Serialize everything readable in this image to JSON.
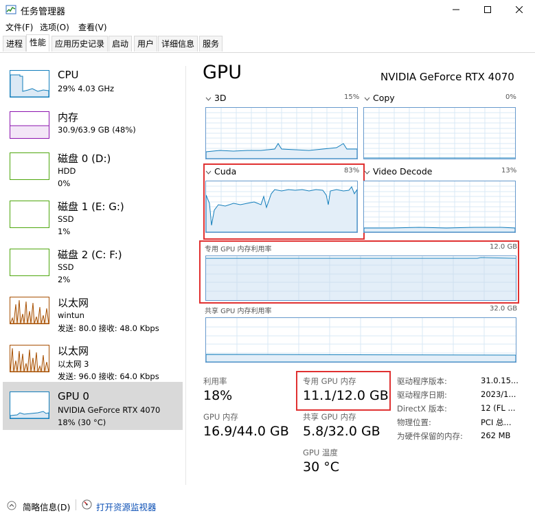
{
  "window": {
    "title": "任务管理器"
  },
  "menu": {
    "file": "文件(F)",
    "options": "选项(O)",
    "view": "查看(V)"
  },
  "tabs": [
    "进程",
    "性能",
    "应用历史记录",
    "启动",
    "用户",
    "详细信息",
    "服务"
  ],
  "sidebar": {
    "cpu": {
      "title": "CPU",
      "line2": "29%  4.03 GHz"
    },
    "memory": {
      "title": "内存",
      "line2": "30.9/63.9 GB (48%)"
    },
    "disk0": {
      "title": "磁盘 0 (D:)",
      "line2": "HDD",
      "line3": "0%"
    },
    "disk1": {
      "title": "磁盘 1 (E: G:)",
      "line2": "SSD",
      "line3": "1%"
    },
    "disk2": {
      "title": "磁盘 2 (C: F:)",
      "line2": "SSD",
      "line3": "2%"
    },
    "eth1": {
      "title": "以太网",
      "line2": "wintun",
      "line3": "发送: 80.0 接收: 48.0 Kbps"
    },
    "eth2": {
      "title": "以太网",
      "line2": "以太网 3",
      "line3": "发送: 96.0 接收: 64.0 Kbps"
    },
    "gpu0": {
      "title": "GPU 0",
      "line2": "NVIDIA GeForce RTX 4070",
      "line3": "18% (30 °C)"
    }
  },
  "main": {
    "title": "GPU",
    "gpu_name": "NVIDIA GeForce RTX 4070",
    "engines": [
      {
        "label": "3D",
        "pct": "15%"
      },
      {
        "label": "Copy",
        "pct": "0%"
      },
      {
        "label": "Cuda",
        "pct": "83%"
      },
      {
        "label": "Video Decode",
        "pct": "13%"
      }
    ],
    "dedicated": {
      "label": "专用 GPU 内存利用率",
      "max": "12.0 GB"
    },
    "shared": {
      "label": "共享 GPU 内存利用率",
      "max": "32.0 GB"
    }
  },
  "stats": {
    "utilization": {
      "label": "利用率",
      "value": "18%"
    },
    "dedicated_mem": {
      "label": "专用 GPU 内存",
      "value": "11.1/12.0 GB"
    },
    "gpu_mem": {
      "label": "GPU 内存",
      "value": "16.9/44.0 GB"
    },
    "shared_mem": {
      "label": "共享 GPU 内存",
      "value": "5.8/32.0 GB"
    },
    "temp": {
      "label": "GPU 温度",
      "value": "30 °C"
    }
  },
  "info": [
    {
      "label": "驱动程序版本:",
      "value": "31.0.15..."
    },
    {
      "label": "驱动程序日期:",
      "value": "2023/1..."
    },
    {
      "label": "DirectX 版本:",
      "value": "12 (FL ..."
    },
    {
      "label": "物理位置:",
      "value": "PCI 总..."
    },
    {
      "label": "为硬件保留的内存:",
      "value": "262 MB"
    }
  ],
  "footer": {
    "brief": "简略信息(D)",
    "monitor": "打开资源监视器"
  },
  "colors": {
    "cpu": "#117dbb",
    "memory": "#8b12ae",
    "disk": "#4da60c",
    "ethernet": "#a74f01",
    "gpu": "#117dbb",
    "highlight": "#e03030"
  }
}
